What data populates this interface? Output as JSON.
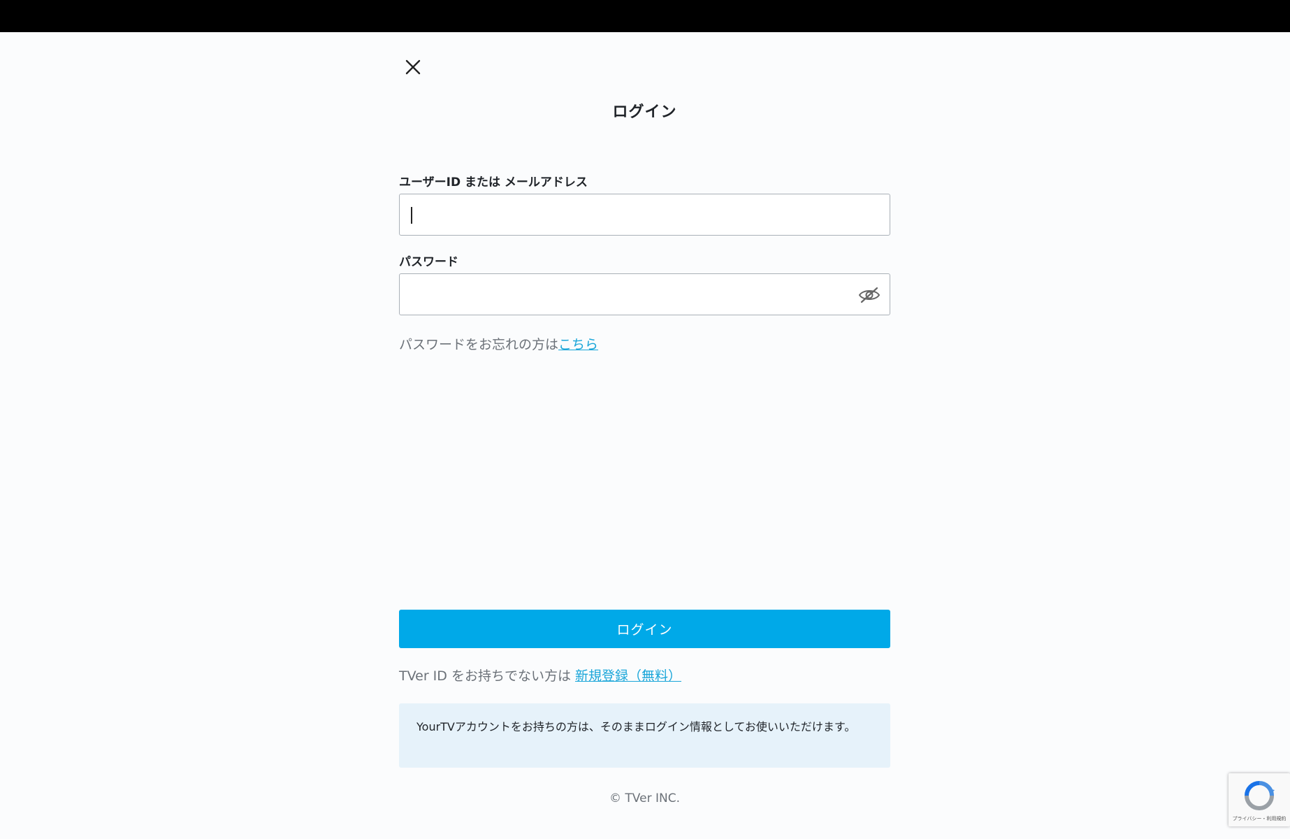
{
  "colors": {
    "accent": "#00a9e8",
    "link": "#1aa6d9",
    "notice_bg": "#e6f2fa",
    "top_bar": "#000000"
  },
  "header": {
    "close_icon": "close-icon",
    "title": "ログイン"
  },
  "form": {
    "user_label": "ユーザーID または メールアドレス",
    "user_value": "",
    "password_label": "パスワード",
    "password_value": "",
    "password_toggle_icon": "eye-slash-icon",
    "forgot_text": "パスワードをお忘れの方は",
    "forgot_link": "こちら",
    "login_button": "ログイン"
  },
  "signup": {
    "text": "TVer ID をお持ちでない方は ",
    "link": "新規登録（無料）"
  },
  "notice": {
    "text": "YourTVアカウントをお持ちの方は、そのままログイン情報としてお使いいただけます。"
  },
  "footer": {
    "copyright": "© TVer INC."
  },
  "recaptcha": {
    "icon": "recaptcha-icon",
    "text": "プライバシー・利用規約"
  }
}
